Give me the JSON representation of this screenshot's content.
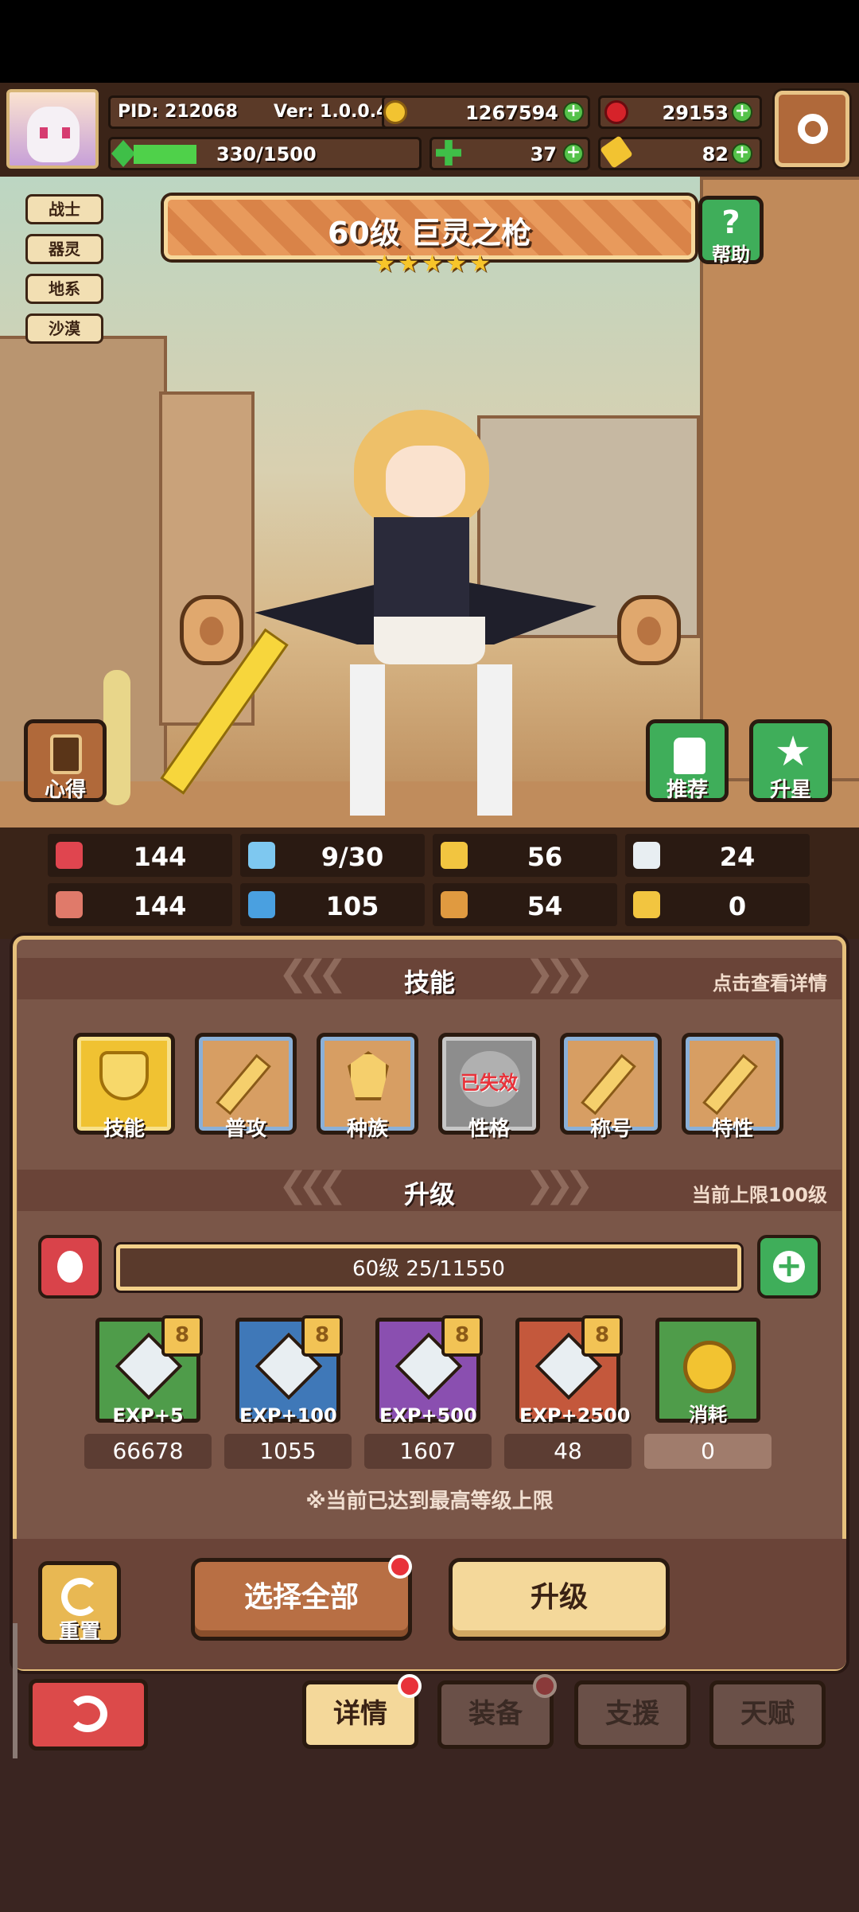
{
  "header": {
    "pid": "PID: 212068",
    "version": "Ver: 1.0.0.4",
    "gold": "1267594",
    "gems": "29153",
    "energy": "330/1500",
    "energy_fraction": 0.22,
    "clover": "37",
    "key": "82"
  },
  "tags": [
    "战士",
    "器灵",
    "地系",
    "沙漠"
  ],
  "hero": {
    "title": "60级  巨灵之枪",
    "stars": 5,
    "help_label": "帮助"
  },
  "side_buttons": {
    "insight": "心得",
    "recommend": "推荐",
    "star_up": "升星"
  },
  "stats": [
    {
      "icon": "heart-icon",
      "value": "144",
      "color": "#e0454f"
    },
    {
      "icon": "water-drop-icon",
      "value": "9/30",
      "color": "#7ec8f0"
    },
    {
      "icon": "shield-icon",
      "value": "56",
      "color": "#f2c540"
    },
    {
      "icon": "feather-icon",
      "value": "24",
      "color": "#e8eef2"
    },
    {
      "icon": "fist-icon",
      "value": "144",
      "color": "#e07a6a"
    },
    {
      "icon": "book-icon",
      "value": "105",
      "color": "#4aa0e0"
    },
    {
      "icon": "boot-icon",
      "value": "54",
      "color": "#e09a40"
    },
    {
      "icon": "magnet-icon",
      "value": "0",
      "color": "#f2c540"
    }
  ],
  "skills_section": {
    "title": "技能",
    "hint": "点击查看详情",
    "items": [
      {
        "label": "技能",
        "icon": "heart-shield-icon"
      },
      {
        "label": "普攻",
        "icon": "sword-icon"
      },
      {
        "label": "种族",
        "icon": "crest-icon"
      },
      {
        "label": "性格",
        "icon": "disabled-icon",
        "overlay": "已失效"
      },
      {
        "label": "称号",
        "icon": "sword-icon"
      },
      {
        "label": "特性",
        "icon": "sword-icon"
      }
    ]
  },
  "upgrade_section": {
    "title": "升级",
    "hint": "当前上限100级",
    "level_text": "60级  25/11550",
    "items": [
      {
        "label": "EXP+5",
        "badge": "8",
        "count": "66678",
        "color": "#4f9c4a"
      },
      {
        "label": "EXP+100",
        "badge": "8",
        "count": "1055",
        "color": "#3f78b8"
      },
      {
        "label": "EXP+500",
        "badge": "8",
        "count": "1607",
        "color": "#8a4fb0"
      },
      {
        "label": "EXP+2500",
        "badge": "8",
        "count": "48",
        "color": "#c4583c"
      },
      {
        "label": "消耗",
        "count": "0",
        "color": "#4f9c4a"
      }
    ],
    "notice": "※当前已达到最高等级上限"
  },
  "actions": {
    "reset": "重置",
    "select_all": "选择全部",
    "upgrade": "升级"
  },
  "tabs": [
    "详情",
    "装备",
    "支援",
    "天赋"
  ]
}
